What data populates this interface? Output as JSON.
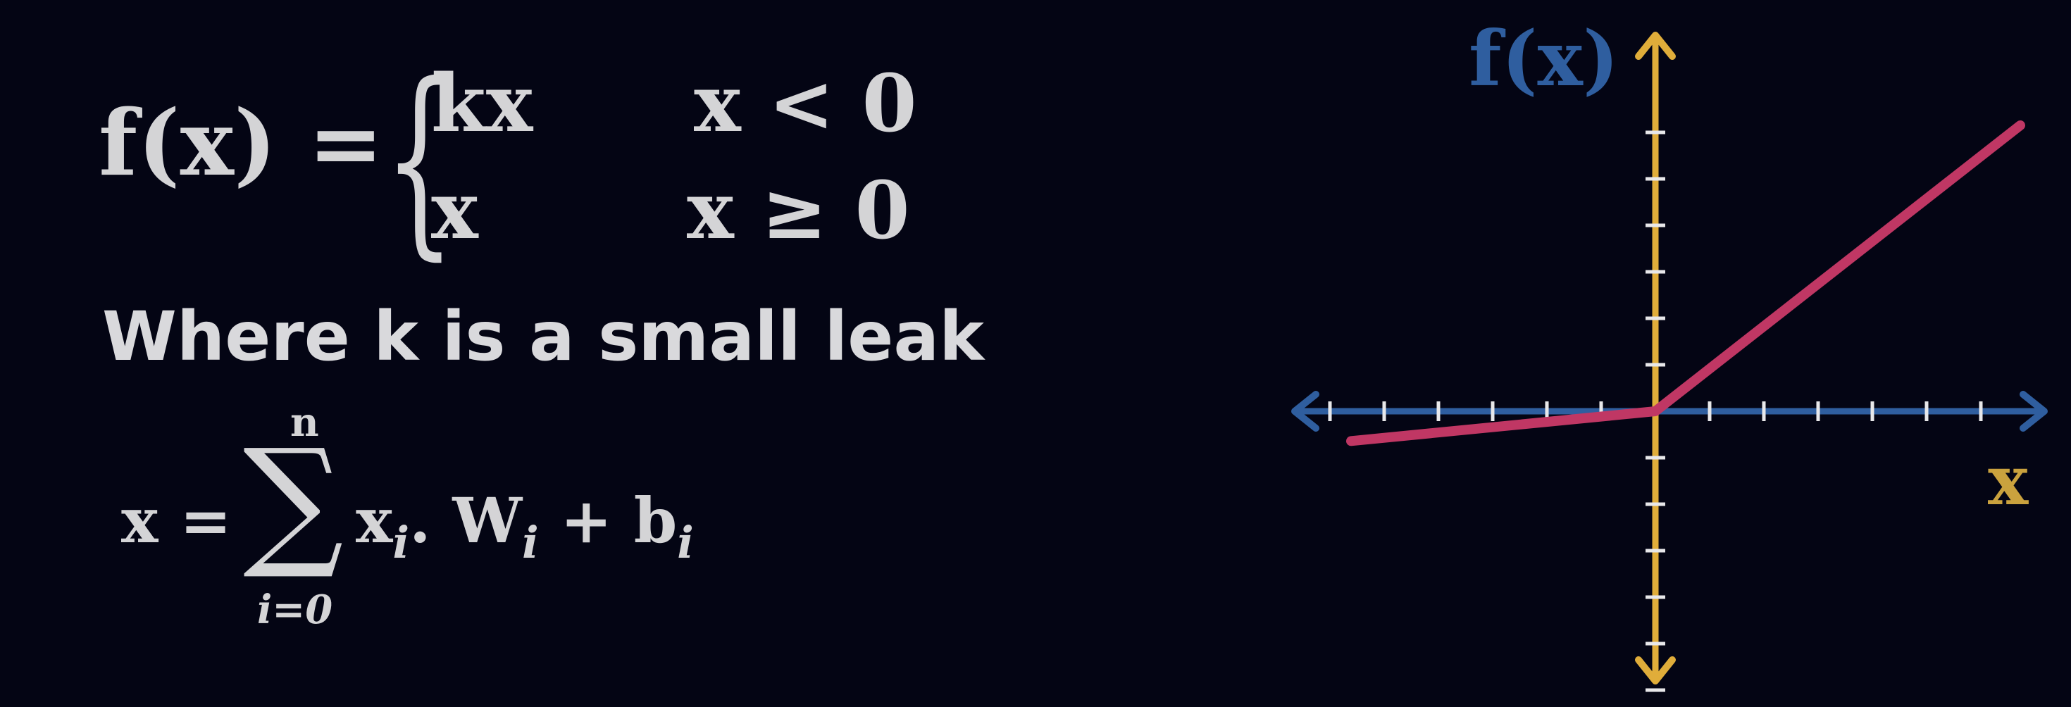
{
  "formula": {
    "lhs": "f(x) = ",
    "brace": "{",
    "case1_expr": "kx",
    "case1_cond": "x < 0",
    "case2_expr": "x",
    "case2_cond": "x ≥ 0"
  },
  "caption": "Where k is a small leak",
  "summation": {
    "lhs": "x = ",
    "sigma": "∑",
    "upper": "n",
    "lower": "i=0",
    "term1": "x",
    "sub1": "i",
    "dot": ". ",
    "term2": "W",
    "sub2": "i",
    "plus": " + b",
    "sub3": "i"
  },
  "plot": {
    "y_axis_label": "f(x)",
    "x_axis_label": "x",
    "x_ticks_each_side": 6,
    "y_ticks_each_side": 6,
    "leak_slope": 0.1,
    "colors": {
      "background": "#040514",
      "x_axis": "#2f5e9f",
      "y_axis": "#e0ad3a",
      "curve": "#c03764",
      "tick": "#e8e8ea",
      "text": "#d4d4d6"
    }
  }
}
